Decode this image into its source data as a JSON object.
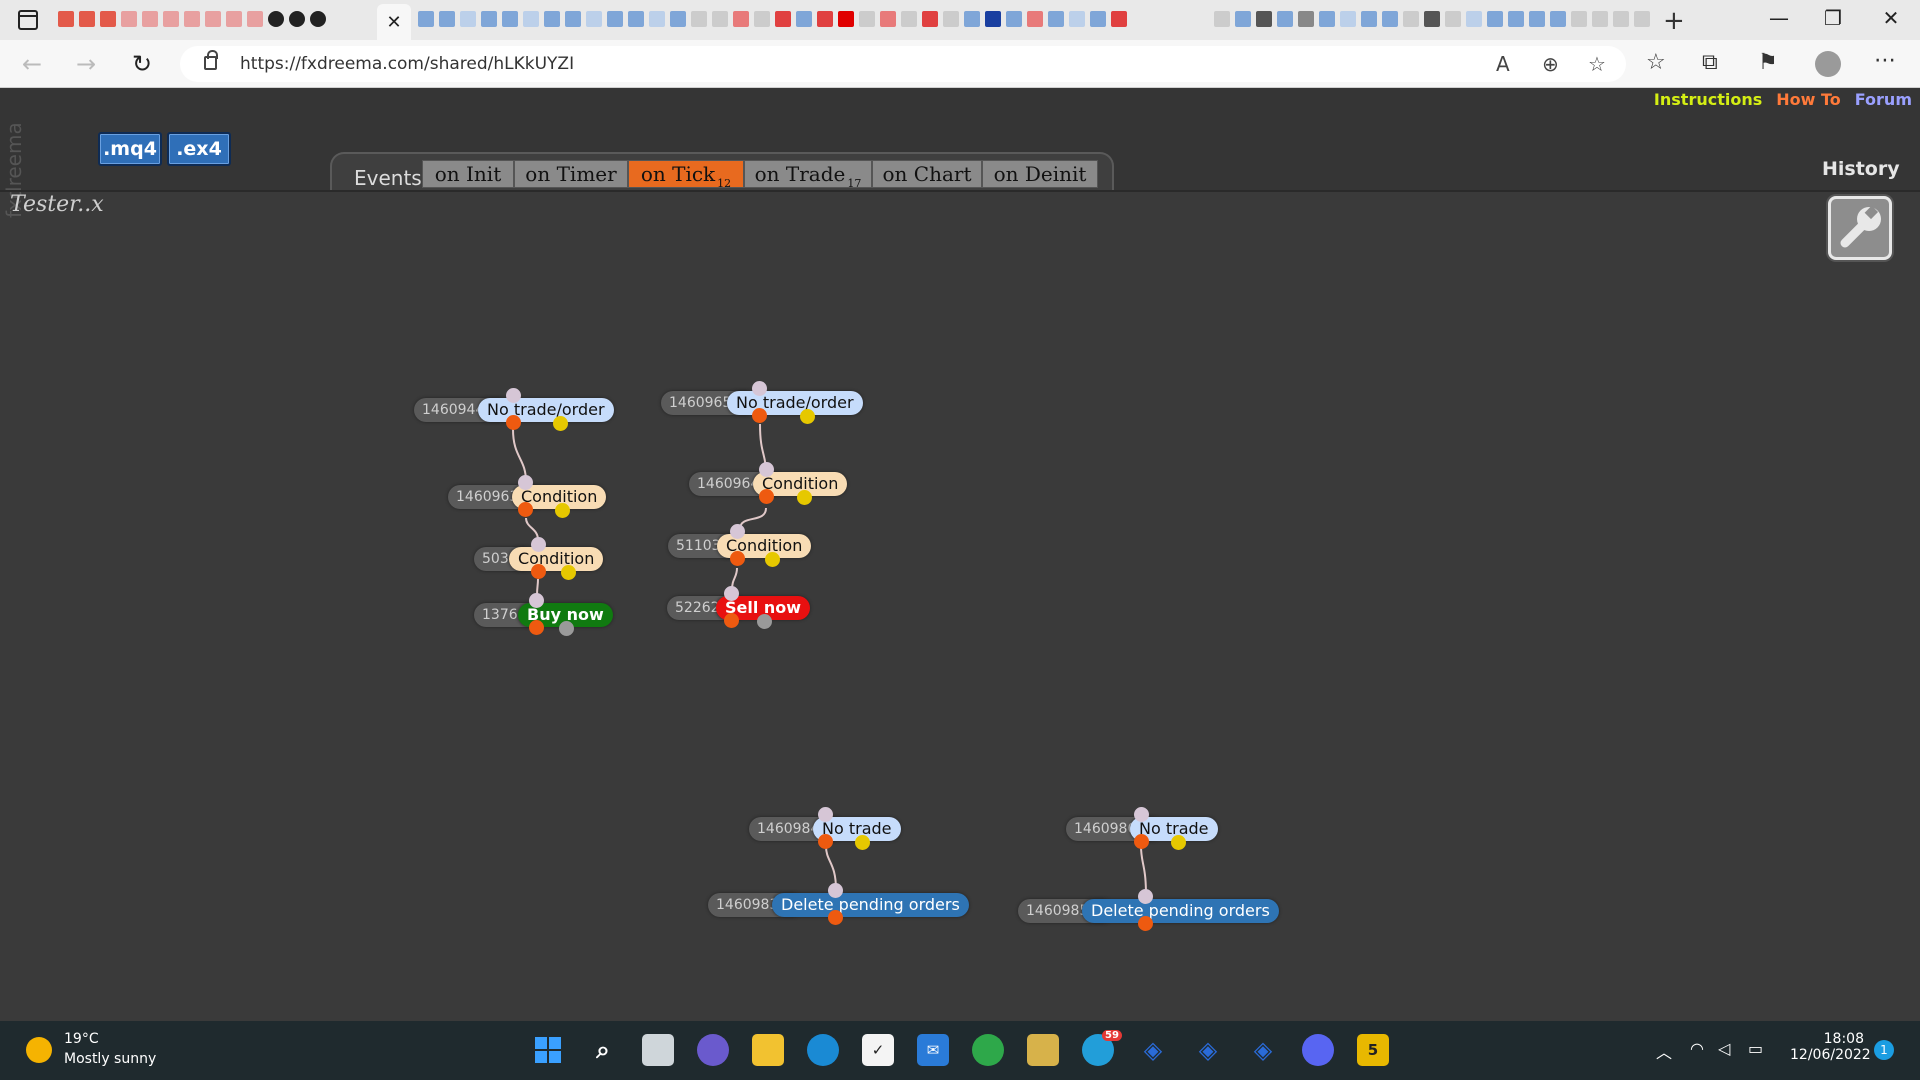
{
  "browser": {
    "active_tab_close": "✕",
    "url": "https://fxdreema.com/shared/hLKkUYZI"
  },
  "page": {
    "brand": "fxdreema",
    "links": {
      "instructions": "Instructions",
      "howto": "How To",
      "forum": "Forum"
    },
    "file_buttons": {
      "mq4": ".mq4",
      "ex4": ".ex4"
    },
    "events_label": "Events",
    "tabs": {
      "init": {
        "label": "on Init",
        "count": ""
      },
      "timer": {
        "label": "on Timer",
        "count": ""
      },
      "tick": {
        "label": "on Tick",
        "count": "12"
      },
      "trade": {
        "label": "on Trade",
        "count": "17"
      },
      "chart": {
        "label": "on Chart",
        "count": ""
      },
      "deinit": {
        "label": "on Deinit",
        "count": ""
      }
    },
    "history": "History",
    "project_title": "Tester..x"
  },
  "blocks": {
    "b1460944": {
      "id": "1460944",
      "label": "No trade/order"
    },
    "b1460963": {
      "id": "1460963",
      "label": "Condition"
    },
    "b503": {
      "id": "503",
      "label": "Condition"
    },
    "b1376": {
      "id": "1376",
      "label": "Buy now"
    },
    "b1460965": {
      "id": "1460965",
      "label": "No trade/order"
    },
    "b1460964": {
      "id": "1460964",
      "label": "Condition"
    },
    "b51103": {
      "id": "51103",
      "label": "Condition"
    },
    "b52262": {
      "id": "52262",
      "label": "Sell now"
    },
    "b1460984": {
      "id": "1460984",
      "label": "No trade"
    },
    "b1460983": {
      "id": "1460983",
      "label": "Delete pending orders"
    },
    "b1460986": {
      "id": "1460986",
      "label": "No trade"
    },
    "b1460985": {
      "id": "1460985",
      "label": "Delete pending orders"
    }
  },
  "taskbar": {
    "weather_temp": "19°C",
    "weather_desc": "Mostly sunny",
    "telegram_badge": "59",
    "time": "18:08",
    "date": "12/06/2022",
    "notifications": "1"
  }
}
